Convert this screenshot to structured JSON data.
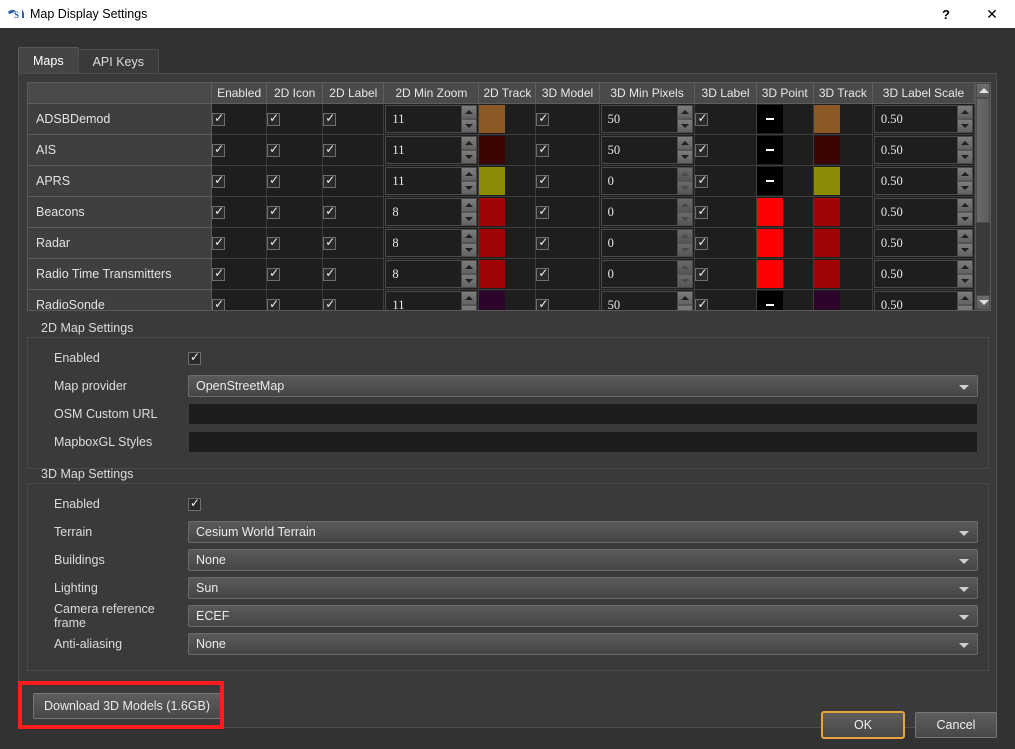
{
  "window": {
    "title": "Map Display Settings",
    "icon": "sdrangel-icon",
    "help_label": "?",
    "close_label": "✕"
  },
  "tabs": [
    {
      "label": "Maps",
      "active": true
    },
    {
      "label": "API Keys",
      "active": false
    }
  ],
  "table": {
    "columns": [
      "",
      "Enabled",
      "2D Icon",
      "2D Label",
      "2D Min Zoom",
      "2D Track",
      "3D Model",
      "3D Min Pixels",
      "3D Label",
      "3D Point",
      "3D Track",
      "3D Label Scale"
    ],
    "rows": [
      {
        "name": "ADSBDemod",
        "enabled": true,
        "icon_2d": true,
        "label_2d": true,
        "min_zoom_2d": "11",
        "track_2d_color": "#8b5a24",
        "model_3d": true,
        "min_pixels_3d": "50",
        "label_3d": true,
        "point_3d_color": "#000000",
        "point_3d_is_dash": true,
        "track_3d_color": "#8b5a24",
        "label_scale_3d": "0.50"
      },
      {
        "name": "AIS",
        "enabled": true,
        "icon_2d": true,
        "label_2d": true,
        "min_zoom_2d": "11",
        "track_2d_color": "#3d0404",
        "model_3d": true,
        "min_pixels_3d": "50",
        "label_3d": true,
        "point_3d_color": "#000000",
        "point_3d_is_dash": true,
        "track_3d_color": "#3d0404",
        "label_scale_3d": "0.50"
      },
      {
        "name": "APRS",
        "enabled": true,
        "icon_2d": true,
        "label_2d": true,
        "min_zoom_2d": "11",
        "track_2d_color": "#8b8b08",
        "model_3d": true,
        "min_pixels_3d": "0",
        "label_3d": true,
        "point_3d_color": "#000000",
        "point_3d_is_dash": true,
        "track_3d_color": "#8b8b08",
        "label_scale_3d": "0.50"
      },
      {
        "name": "Beacons",
        "enabled": true,
        "icon_2d": true,
        "label_2d": true,
        "min_zoom_2d": "8",
        "track_2d_color": "#a00505",
        "model_3d": true,
        "min_pixels_3d": "0",
        "label_3d": true,
        "point_3d_color": "#ff0000",
        "point_3d_is_dash": false,
        "track_3d_color": "#a00505",
        "label_scale_3d": "0.50"
      },
      {
        "name": "Radar",
        "enabled": true,
        "icon_2d": true,
        "label_2d": true,
        "min_zoom_2d": "8",
        "track_2d_color": "#a00505",
        "model_3d": true,
        "min_pixels_3d": "0",
        "label_3d": true,
        "point_3d_color": "#ff0000",
        "point_3d_is_dash": false,
        "track_3d_color": "#a00505",
        "label_scale_3d": "0.50"
      },
      {
        "name": "Radio Time Transmitters",
        "enabled": true,
        "icon_2d": true,
        "label_2d": true,
        "min_zoom_2d": "8",
        "track_2d_color": "#a00505",
        "model_3d": true,
        "min_pixels_3d": "0",
        "label_3d": true,
        "point_3d_color": "#ff0000",
        "point_3d_is_dash": false,
        "track_3d_color": "#a00505",
        "label_scale_3d": "0.50"
      },
      {
        "name": "RadioSonde",
        "enabled": true,
        "icon_2d": true,
        "label_2d": true,
        "min_zoom_2d": "11",
        "track_2d_color": "#2e0329",
        "model_3d": true,
        "min_pixels_3d": "50",
        "label_3d": true,
        "point_3d_color": "#000000",
        "point_3d_is_dash": true,
        "track_3d_color": "#2e0329",
        "label_scale_3d": "0.50"
      }
    ]
  },
  "map2d": {
    "title": "2D Map Settings",
    "fields": [
      {
        "label": "Enabled",
        "type": "checkbox",
        "checked": true
      },
      {
        "label": "Map provider",
        "type": "combo",
        "value": "OpenStreetMap"
      },
      {
        "label": "OSM Custom URL",
        "type": "text",
        "value": ""
      },
      {
        "label": "MapboxGL Styles",
        "type": "text",
        "value": ""
      }
    ]
  },
  "map3d": {
    "title": "3D Map Settings",
    "fields": [
      {
        "label": "Enabled",
        "type": "checkbox",
        "checked": true
      },
      {
        "label": "Terrain",
        "type": "combo",
        "value": "Cesium World Terrain"
      },
      {
        "label": "Buildings",
        "type": "combo",
        "value": "None"
      },
      {
        "label": "Lighting",
        "type": "combo",
        "value": "Sun"
      },
      {
        "label": "Camera reference frame",
        "type": "combo",
        "value": "ECEF"
      },
      {
        "label": "Anti-aliasing",
        "type": "combo",
        "value": "None"
      }
    ]
  },
  "download": {
    "label": "Download 3D Models (1.6GB)",
    "highlight_color": "#ff1c1c"
  },
  "footer": {
    "ok_label": "OK",
    "cancel_label": "Cancel",
    "default_focus_color": "#e8a33d"
  }
}
